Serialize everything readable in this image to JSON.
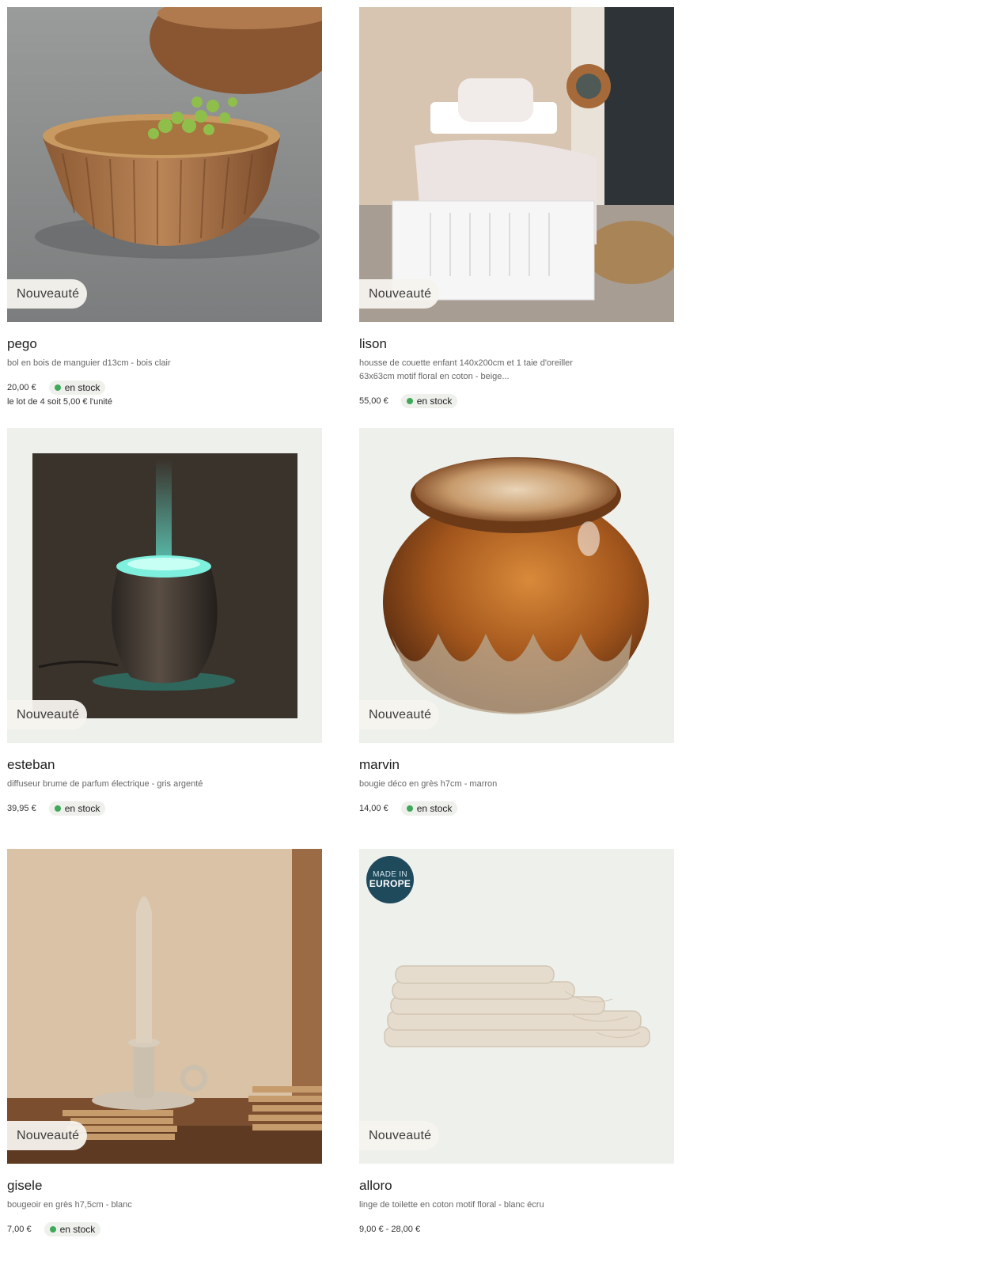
{
  "products": [
    {
      "name": "pego",
      "description": "bol en bois de manguier d13cm - bois clair",
      "price": "20,00 €",
      "stock": "en stock",
      "unit_note": "le lot de 4 soit 5,00 € l'unité",
      "badge": "Nouveauté"
    },
    {
      "name": "lison",
      "description": "housse de couette enfant 140x200cm et 1 taie d'oreiller 63x63cm motif floral en coton - beige...",
      "price": "55,00 €",
      "stock": "en stock",
      "badge": "Nouveauté"
    },
    {
      "name": "esteban",
      "description": "diffuseur brume de parfum électrique - gris argenté",
      "price": "39,95 €",
      "stock": "en stock",
      "badge": "Nouveauté"
    },
    {
      "name": "marvin",
      "description": "bougie déco en grès h7cm - marron",
      "price": "14,00 €",
      "stock": "en stock",
      "badge": "Nouveauté"
    },
    {
      "name": "gisele",
      "description": "bougeoir en grès h7,5cm - blanc",
      "price": "7,00 €",
      "stock": "en stock",
      "badge": "Nouveauté"
    },
    {
      "name": "alloro",
      "description": "linge de toilette en coton motif floral - blanc écru",
      "price": "9,00 € - 28,00 €",
      "badge": "Nouveauté",
      "origin_badge": {
        "line1": "MADE IN",
        "line2": "EUROPE"
      }
    }
  ],
  "colors": {
    "stock_dot": "#3fa85a",
    "badge_bg": "#f5f3ee",
    "origin_badge_bg": "#1f4a5c",
    "image_bg": "#eef0ec"
  }
}
